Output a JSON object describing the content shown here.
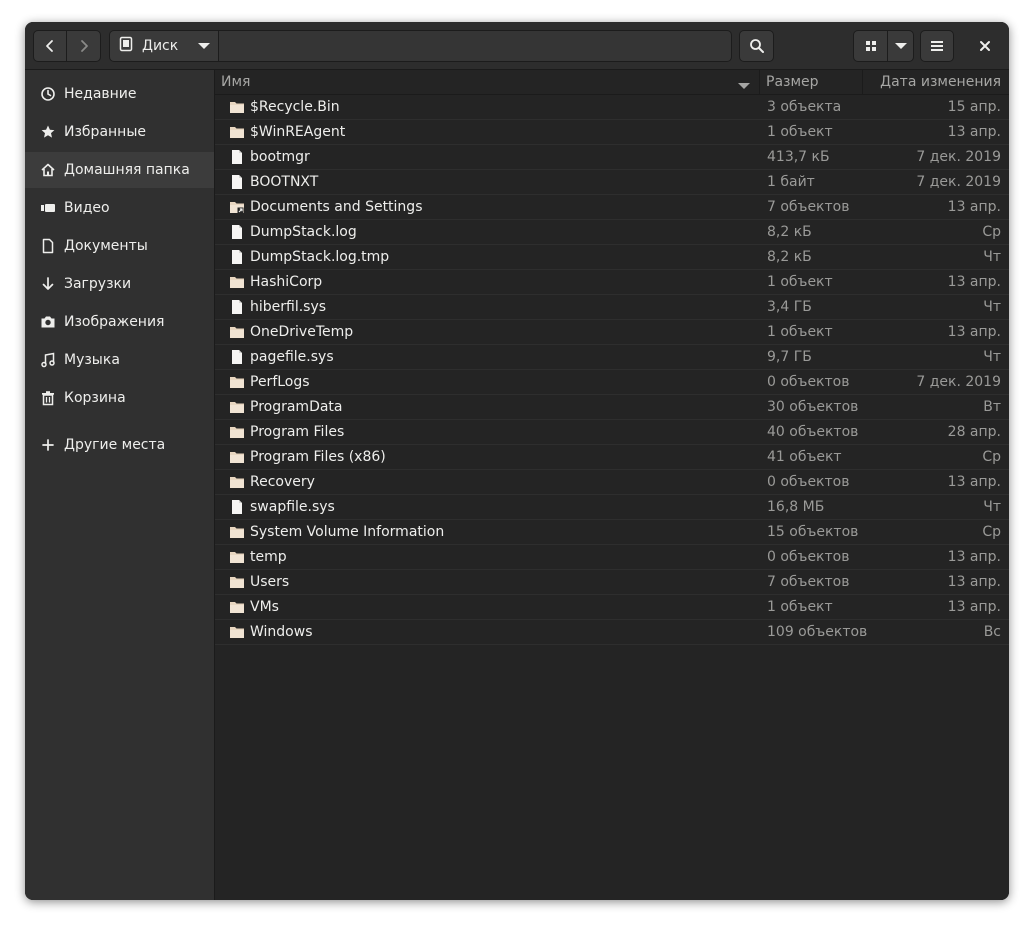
{
  "toolbar": {
    "back_icon": "go-previous-icon",
    "forward_icon": "go-next-icon",
    "location_label": "Диск",
    "search_icon": "search-icon",
    "view_icon": "grid-view-icon",
    "view_options_icon": "chevron-down-icon",
    "menu_icon": "hamburger-menu-icon",
    "close_icon": "close-icon"
  },
  "sidebar": {
    "items": [
      {
        "label": "Недавние",
        "icon": "clock-icon",
        "active": false
      },
      {
        "label": "Избранные",
        "icon": "star-icon",
        "active": false
      },
      {
        "label": "Домашняя папка",
        "icon": "home-icon",
        "active": true
      },
      {
        "label": "Видео",
        "icon": "video-icon",
        "active": false
      },
      {
        "label": "Документы",
        "icon": "document-icon",
        "active": false
      },
      {
        "label": "Загрузки",
        "icon": "download-icon",
        "active": false
      },
      {
        "label": "Изображения",
        "icon": "camera-icon",
        "active": false
      },
      {
        "label": "Музыка",
        "icon": "music-icon",
        "active": false
      },
      {
        "label": "Корзина",
        "icon": "trash-icon",
        "active": false
      }
    ],
    "other_locations": {
      "label": "Другие места",
      "icon": "plus-icon"
    }
  },
  "columns": {
    "name": "Имя",
    "size": "Размер",
    "modified": "Дата изменения"
  },
  "colors": {
    "window_bg": "#242424",
    "sidebar_bg": "#303030",
    "folder": "#e8d6c0",
    "text": "#eeeeec",
    "dim_text": "#9a9a98"
  },
  "files": [
    {
      "name": "$Recycle.Bin",
      "type": "folder",
      "size": "3 объекта",
      "date": "15 апр."
    },
    {
      "name": "$WinREAgent",
      "type": "folder",
      "size": "1 объект",
      "date": "13 апр."
    },
    {
      "name": "bootmgr",
      "type": "file",
      "size": "413,7 кБ",
      "date": "7 дек. 2019"
    },
    {
      "name": "BOOTNXT",
      "type": "file",
      "size": "1 байт",
      "date": "7 дек. 2019"
    },
    {
      "name": "Documents and Settings",
      "type": "folder-link",
      "size": "7 объектов",
      "date": "13 апр."
    },
    {
      "name": "DumpStack.log",
      "type": "file",
      "size": "8,2 кБ",
      "date": "Ср"
    },
    {
      "name": "DumpStack.log.tmp",
      "type": "file",
      "size": "8,2 кБ",
      "date": "Чт"
    },
    {
      "name": "HashiCorp",
      "type": "folder",
      "size": "1 объект",
      "date": "13 апр."
    },
    {
      "name": "hiberfil.sys",
      "type": "file",
      "size": "3,4 ГБ",
      "date": "Чт"
    },
    {
      "name": "OneDriveTemp",
      "type": "folder",
      "size": "1 объект",
      "date": "13 апр."
    },
    {
      "name": "pagefile.sys",
      "type": "file",
      "size": "9,7 ГБ",
      "date": "Чт"
    },
    {
      "name": "PerfLogs",
      "type": "folder",
      "size": "0 объектов",
      "date": "7 дек. 2019"
    },
    {
      "name": "ProgramData",
      "type": "folder",
      "size": "30 объектов",
      "date": "Вт"
    },
    {
      "name": "Program Files",
      "type": "folder",
      "size": "40 объектов",
      "date": "28 апр."
    },
    {
      "name": "Program Files (x86)",
      "type": "folder",
      "size": "41 объект",
      "date": "Ср"
    },
    {
      "name": "Recovery",
      "type": "folder",
      "size": "0 объектов",
      "date": "13 апр."
    },
    {
      "name": "swapfile.sys",
      "type": "file",
      "size": "16,8 МБ",
      "date": "Чт"
    },
    {
      "name": "System Volume Information",
      "type": "folder",
      "size": "15 объектов",
      "date": "Ср"
    },
    {
      "name": "temp",
      "type": "folder",
      "size": "0 объектов",
      "date": "13 апр."
    },
    {
      "name": "Users",
      "type": "folder",
      "size": "7 объектов",
      "date": "13 апр."
    },
    {
      "name": "VMs",
      "type": "folder",
      "size": "1 объект",
      "date": "13 апр."
    },
    {
      "name": "Windows",
      "type": "folder",
      "size": "109 объектов",
      "date": "Вс"
    }
  ]
}
